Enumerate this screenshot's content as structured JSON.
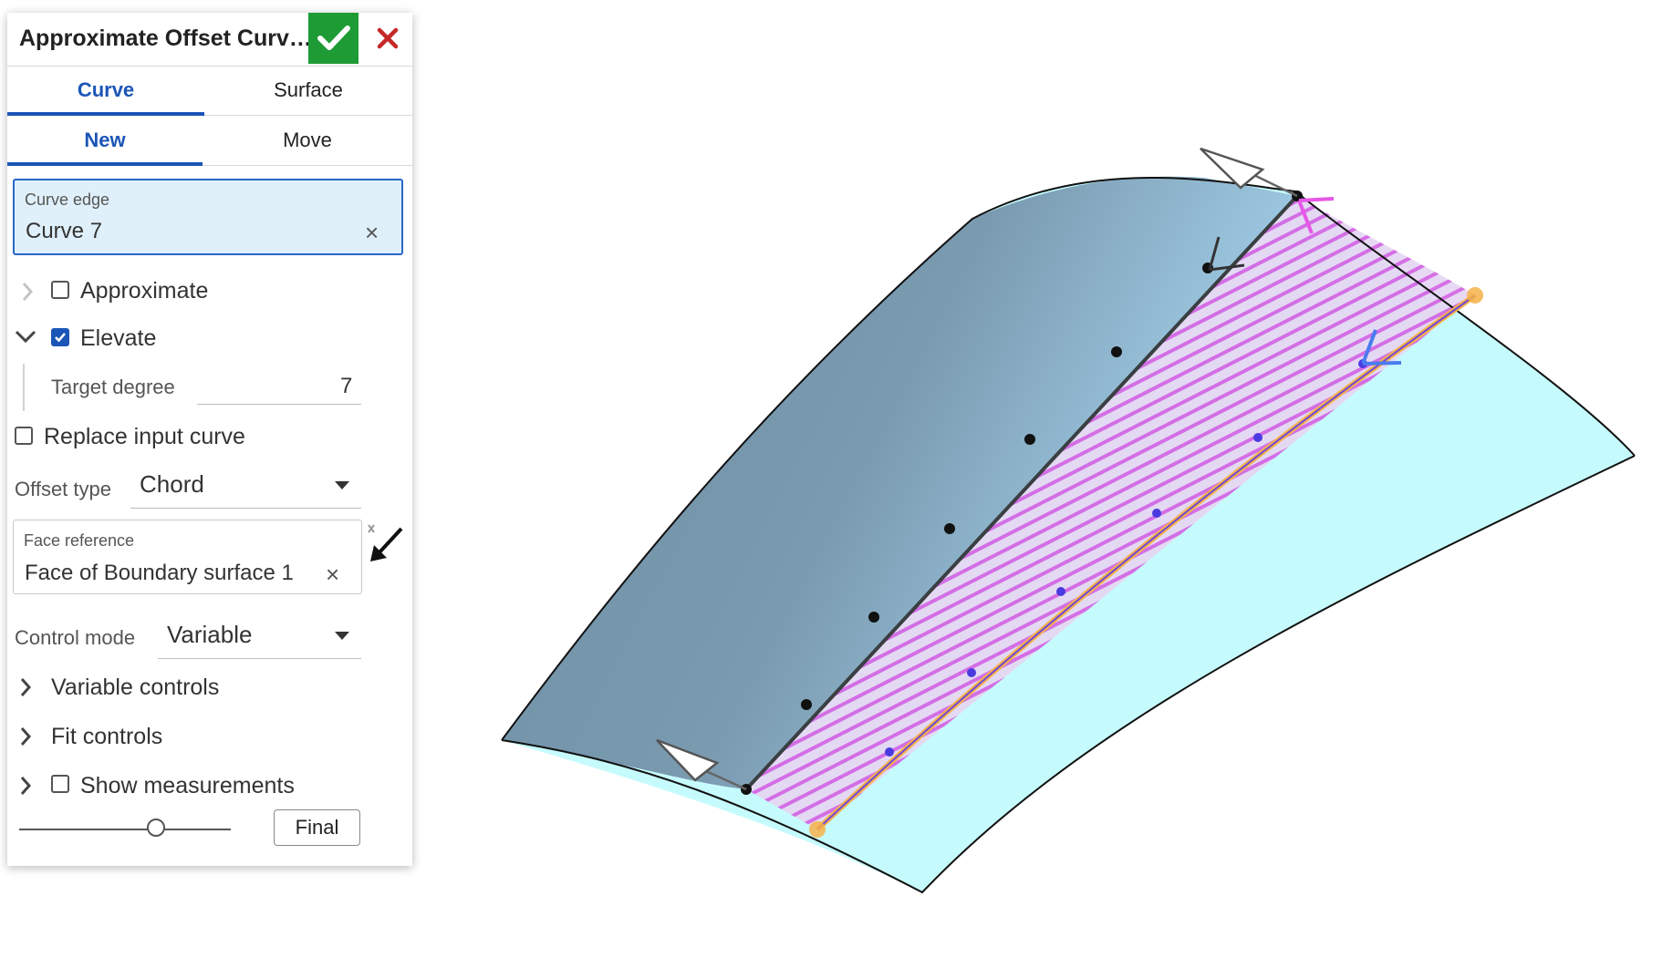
{
  "dialog": {
    "title": "Approximate Offset Curv…",
    "ok_icon": "checkmark-icon",
    "cancel_icon": "close-icon",
    "colors": {
      "accent": "#1b55b7",
      "ok": "#1e9b35",
      "cancel": "#c62828"
    }
  },
  "tabs_primary": [
    {
      "label": "Curve",
      "active": true
    },
    {
      "label": "Surface",
      "active": false
    }
  ],
  "tabs_secondary": [
    {
      "label": "New",
      "active": true
    },
    {
      "label": "Move",
      "active": false
    }
  ],
  "curve_edge": {
    "label": "Curve edge",
    "value": "Curve 7"
  },
  "approximate": {
    "label": "Approximate",
    "checked": false,
    "expanded": false
  },
  "elevate": {
    "label": "Elevate",
    "checked": true,
    "expanded": true
  },
  "target_degree": {
    "label": "Target degree",
    "value": "7"
  },
  "replace_input": {
    "label": "Replace input curve",
    "checked": false
  },
  "offset_type": {
    "label": "Offset type",
    "value": "Chord"
  },
  "face_reference": {
    "label": "Face reference",
    "value": "Face of Boundary surface 1"
  },
  "control_mode": {
    "label": "Control mode",
    "value": "Variable"
  },
  "variable_controls": {
    "label": "Variable controls",
    "expanded": false
  },
  "fit_controls": {
    "label": "Fit controls",
    "expanded": false
  },
  "show_measurements": {
    "label": "Show measurements",
    "checked": false,
    "expanded": false
  },
  "rollback": {
    "final_label": "Final",
    "slider_fraction": 0.62
  },
  "viewport": {
    "colors": {
      "surface_dark": "#6e8ea2",
      "surface_light": "#a6d5f0",
      "surface_cyan": "#c6fbfd",
      "hatch": "#d66ae6",
      "offset_curve": "#f5b24a"
    }
  }
}
